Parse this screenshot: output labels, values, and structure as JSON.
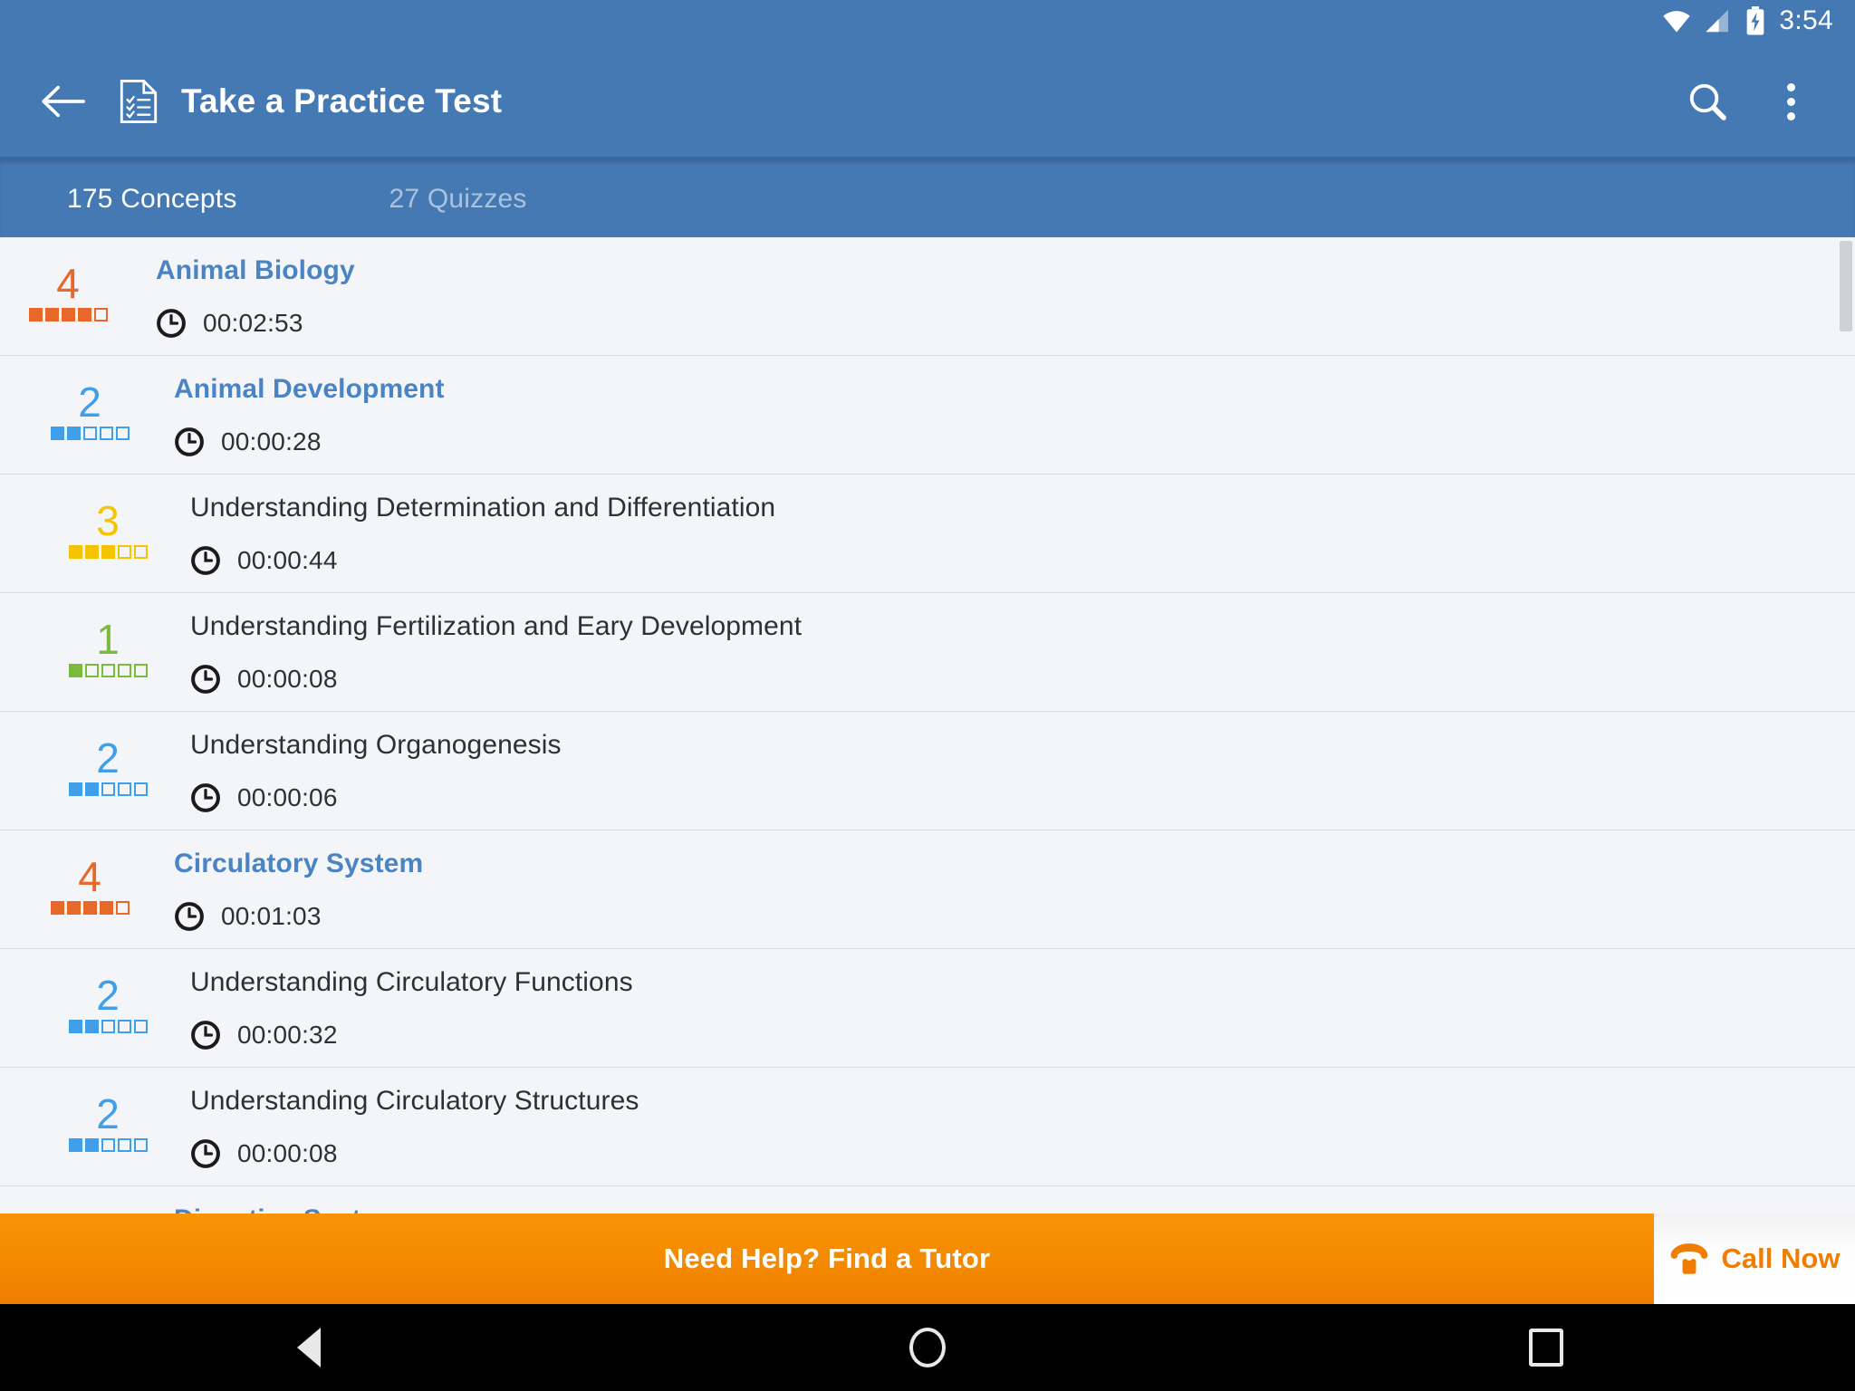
{
  "statusbar": {
    "time": "3:54",
    "icons": [
      "wifi-icon",
      "cell-signal-icon",
      "battery-charging-icon"
    ]
  },
  "appbar": {
    "back_icon": "back-arrow-icon",
    "title_icon": "practice-test-document-icon",
    "title": "Take a Practice Test",
    "search_icon": "search-icon",
    "overflow_icon": "overflow-menu-icon"
  },
  "tabs": [
    {
      "label": "175 Concepts",
      "active": true
    },
    {
      "label": "27 Quizzes",
      "active": false
    }
  ],
  "colors": {
    "header_blue": "#4479b4",
    "link_blue": "#4a84c4",
    "rating_1": "#7cba3d",
    "rating_2": "#3f9fe8",
    "rating_3": "#f5c400",
    "rating_4": "#e8682b",
    "banner_orange": "#f58b00",
    "list_bg": "#f4f5f8"
  },
  "list": {
    "rows": [
      {
        "title": "Animal Biology",
        "level": 0,
        "header": true,
        "rating": 4,
        "rating_max": 5,
        "rating_color": "#e8682b",
        "time": "00:02:53",
        "clock_icon": "clock-icon"
      },
      {
        "title": "Animal Development",
        "level": 1,
        "header": true,
        "rating": 2,
        "rating_max": 5,
        "rating_color": "#3f9fe8",
        "time": "00:00:28",
        "clock_icon": "clock-icon"
      },
      {
        "title": "Understanding Determination and Differentiation",
        "level": 2,
        "header": false,
        "rating": 3,
        "rating_max": 5,
        "rating_color": "#f5c400",
        "time": "00:00:44",
        "clock_icon": "clock-icon"
      },
      {
        "title": "Understanding Fertilization and Eary Development",
        "level": 2,
        "header": false,
        "rating": 1,
        "rating_max": 5,
        "rating_color": "#7cba3d",
        "time": "00:00:08",
        "clock_icon": "clock-icon"
      },
      {
        "title": "Understanding Organogenesis",
        "level": 2,
        "header": false,
        "rating": 2,
        "rating_max": 5,
        "rating_color": "#3f9fe8",
        "time": "00:00:06",
        "clock_icon": "clock-icon"
      },
      {
        "title": "Circulatory System",
        "level": 1,
        "header": true,
        "rating": 4,
        "rating_max": 5,
        "rating_color": "#e8682b",
        "time": "00:01:03",
        "clock_icon": "clock-icon"
      },
      {
        "title": "Understanding Circulatory Functions",
        "level": 2,
        "header": false,
        "rating": 2,
        "rating_max": 5,
        "rating_color": "#3f9fe8",
        "time": "00:00:32",
        "clock_icon": "clock-icon"
      },
      {
        "title": "Understanding Circulatory Structures",
        "level": 2,
        "header": false,
        "rating": 2,
        "rating_max": 5,
        "rating_color": "#3f9fe8",
        "time": "00:00:08",
        "clock_icon": "clock-icon"
      },
      {
        "title": "Digestive System",
        "level": 1,
        "header": true,
        "rating": null,
        "rating_max": 5,
        "rating_color": "#e8682b",
        "time": "",
        "clock_icon": "clock-icon",
        "clipped": true
      }
    ]
  },
  "banner": {
    "message": "Need Help? Find a Tutor",
    "call_label": "Call Now",
    "phone_icon": "telephone-icon"
  },
  "navbar": {
    "back": "nav-back-icon",
    "home": "nav-home-icon",
    "recents": "nav-recents-icon"
  }
}
